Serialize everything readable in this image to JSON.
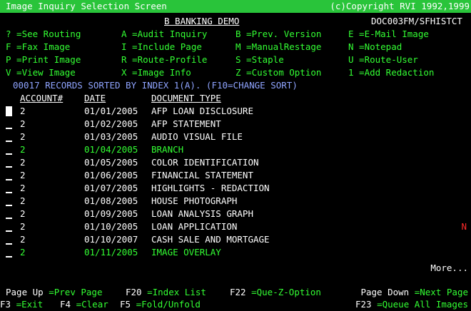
{
  "title_bar": {
    "left": "Image Inquiry Selection Screen",
    "right": "(c)Copyright RVI 1992,1999"
  },
  "header": {
    "app_name": "B BANKING DEMO",
    "program_id": "DOC003FM/SFHISTCT"
  },
  "options": [
    [
      "? =See Routing",
      "A =Audit Inquiry",
      "B =Prev. Version",
      "E =E-Mail Image"
    ],
    [
      "F =Fax Image",
      "I =Include Page",
      "M =ManualRestage",
      "N =Notepad"
    ],
    [
      "P =Print Image",
      "R =Route-Profile",
      "S =Staple",
      "U =Route-User"
    ],
    [
      "V =View Image",
      "X =Image Info",
      "Z =Custom Option",
      "1 =Add Redaction"
    ]
  ],
  "records_info": "00017 RECORDS SORTED BY INDEX 1(A). (F10=CHANGE SORT)",
  "columns": {
    "account": "ACCOUNT#",
    "date": "DATE",
    "doc_type": "DOCUMENT TYPE"
  },
  "rows": [
    {
      "account": "2",
      "date": "01/01/2005",
      "doc_type": "AFP LOAN DISCLOSURE",
      "color": "#ffffff",
      "flag": ""
    },
    {
      "account": "2",
      "date": "01/02/2005",
      "doc_type": "AFP STATEMENT",
      "color": "#ffffff",
      "flag": ""
    },
    {
      "account": "2",
      "date": "01/03/2005",
      "doc_type": "AUDIO VISUAL FILE",
      "color": "#ffffff",
      "flag": ""
    },
    {
      "account": "2",
      "date": "01/04/2005",
      "doc_type": "BRANCH",
      "color": "#33ff33",
      "flag": ""
    },
    {
      "account": "2",
      "date": "01/05/2005",
      "doc_type": "COLOR IDENTIFICATION",
      "color": "#ffffff",
      "flag": ""
    },
    {
      "account": "2",
      "date": "01/06/2005",
      "doc_type": "FINANCIAL STATEMENT",
      "color": "#ffffff",
      "flag": ""
    },
    {
      "account": "2",
      "date": "01/07/2005",
      "doc_type": "HIGHLIGHTS - REDACTION",
      "color": "#ffffff",
      "flag": ""
    },
    {
      "account": "2",
      "date": "01/08/2005",
      "doc_type": "HOUSE PHOTOGRAPH",
      "color": "#ffffff",
      "flag": ""
    },
    {
      "account": "2",
      "date": "01/09/2005",
      "doc_type": "LOAN ANALYSIS GRAPH",
      "color": "#ffffff",
      "flag": ""
    },
    {
      "account": "2",
      "date": "01/10/2005",
      "doc_type": "LOAN APPLICATION",
      "color": "#ffffff",
      "flag": "N"
    },
    {
      "account": "2",
      "date": "01/10/2007",
      "doc_type": "CASH SALE AND MORTGAGE",
      "color": "#ffffff",
      "flag": ""
    },
    {
      "account": "2",
      "date": "01/11/2005",
      "doc_type": "IMAGE OVERLAY",
      "color": "#33ff33",
      "flag": ""
    }
  ],
  "more": "More...",
  "footer": {
    "line1": [
      {
        "key": "Page Up",
        "desc": "=Prev Page"
      },
      {
        "key": "F20",
        "desc": "=Index List"
      },
      {
        "key": "F22",
        "desc": "=Que-Z-Option"
      },
      {
        "key": "Page Down",
        "desc": "=Next Page"
      }
    ],
    "line2": [
      {
        "key": "F3",
        "desc": "=Exit"
      },
      {
        "key": "F4",
        "desc": "=Clear"
      },
      {
        "key": "F5",
        "desc": "=Fold/Unfold"
      },
      {
        "key": "F23",
        "desc": "=Queue All Images"
      }
    ]
  },
  "colors": {
    "title_bar_bg": "#29c43a",
    "green_text": "#33ff33",
    "blue_text": "#8fa4ff",
    "flag_red": "#ff2a2a"
  }
}
